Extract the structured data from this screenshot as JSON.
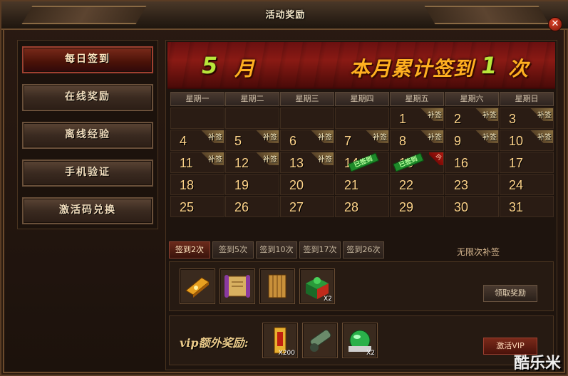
{
  "window": {
    "title": "活动奖励",
    "close_label": "✕"
  },
  "sidebar": {
    "items": [
      {
        "label": "每日签到",
        "active": true
      },
      {
        "label": "在线奖励",
        "active": false
      },
      {
        "label": "离线经验",
        "active": false
      },
      {
        "label": "手机验证",
        "active": false
      },
      {
        "label": "激活码兑换",
        "active": false
      }
    ]
  },
  "banner": {
    "month_num": "5",
    "month_label": "月",
    "cumulative_label": "本月累计签到",
    "count": "1",
    "count_unit": "次"
  },
  "calendar": {
    "weekdays": [
      "星期一",
      "星期二",
      "星期三",
      "星期四",
      "星期五",
      "星期六",
      "星期日"
    ],
    "makeup_tag": "补签",
    "signed_stamp": "已签到",
    "today_tag": "今",
    "weeks": [
      [
        null,
        null,
        null,
        null,
        {
          "d": "1",
          "tag": true
        },
        {
          "d": "2",
          "tag": true
        },
        {
          "d": "3",
          "tag": true
        }
      ],
      [
        {
          "d": "4",
          "tag": true
        },
        {
          "d": "5",
          "tag": true
        },
        {
          "d": "6",
          "tag": true
        },
        {
          "d": "7",
          "tag": true
        },
        {
          "d": "8",
          "tag": true
        },
        {
          "d": "9",
          "tag": true
        },
        {
          "d": "10",
          "tag": true
        }
      ],
      [
        {
          "d": "11",
          "tag": true
        },
        {
          "d": "12",
          "tag": true
        },
        {
          "d": "13",
          "tag": true
        },
        {
          "d": "14",
          "signed": true
        },
        {
          "d": "15",
          "today": true
        },
        {
          "d": "16"
        },
        {
          "d": "17"
        }
      ],
      [
        {
          "d": "18"
        },
        {
          "d": "19"
        },
        {
          "d": "20"
        },
        {
          "d": "21"
        },
        {
          "d": "22"
        },
        {
          "d": "23"
        },
        {
          "d": "24"
        }
      ],
      [
        {
          "d": "25"
        },
        {
          "d": "26"
        },
        {
          "d": "27"
        },
        {
          "d": "28"
        },
        {
          "d": "29"
        },
        {
          "d": "30"
        },
        {
          "d": "31"
        }
      ]
    ]
  },
  "milestones": {
    "tabs": [
      "签到2次",
      "签到5次",
      "签到10次",
      "签到17次",
      "签到26次"
    ],
    "active_index": 0,
    "unlimited_label": "无限次补签"
  },
  "rewards": {
    "items": [
      {
        "icon": "gold-bar-icon",
        "count": ""
      },
      {
        "icon": "scroll-icon",
        "count": ""
      },
      {
        "icon": "bamboo-scroll-icon",
        "count": ""
      },
      {
        "icon": "gift-box-icon",
        "count": "X2"
      }
    ],
    "claim_label": "领取奖励"
  },
  "vip": {
    "label": "vip额外奖励:",
    "items": [
      {
        "icon": "talisman-icon",
        "count": "X200"
      },
      {
        "icon": "cannon-icon",
        "count": ""
      },
      {
        "icon": "jade-bag-icon",
        "count": "X2"
      }
    ],
    "activate_label": "激活VIP"
  },
  "watermark": "酷乐米",
  "colors": {
    "accent_red": "#8a1a14",
    "banner_gold": "#ffb020",
    "banner_green": "#b8e63a",
    "day_number": "#ffd48a"
  }
}
